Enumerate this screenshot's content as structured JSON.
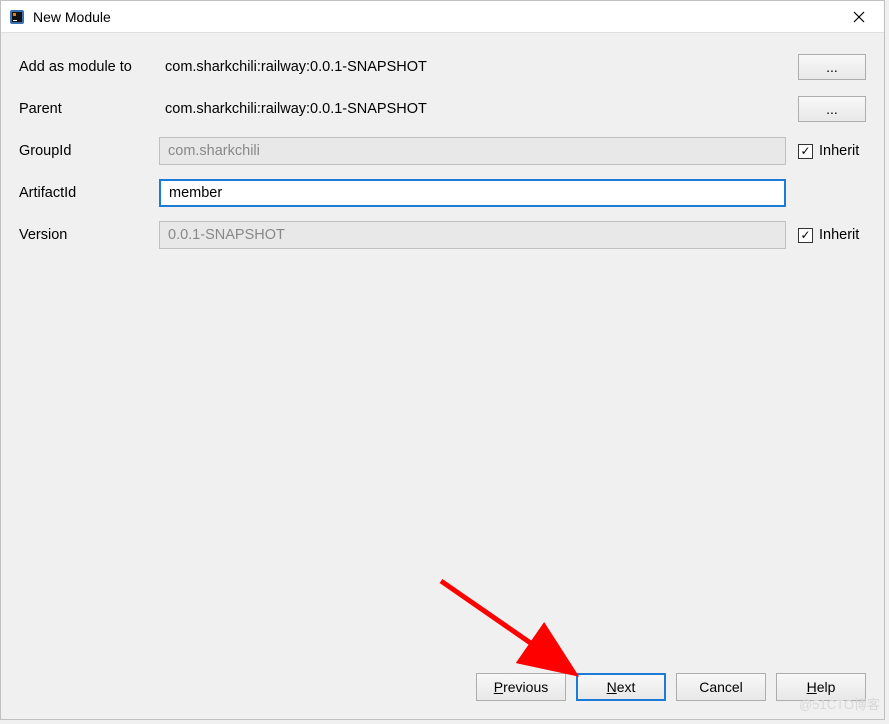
{
  "title_bar": {
    "title": "New Module"
  },
  "form": {
    "add_as_module_to": {
      "label": "Add as module to",
      "value": "com.sharkchili:railway:0.0.1-SNAPSHOT",
      "browse": "..."
    },
    "parent": {
      "label": "Parent",
      "value": "com.sharkchili:railway:0.0.1-SNAPSHOT",
      "browse": "..."
    },
    "group_id": {
      "label": "GroupId",
      "value": "com.sharkchili",
      "inherit_label": "Inherit",
      "inherit_checked": true
    },
    "artifact_id": {
      "label": "ArtifactId",
      "value": "member"
    },
    "version": {
      "label": "Version",
      "value": "0.0.1-SNAPSHOT",
      "inherit_label": "Inherit",
      "inherit_checked": true
    }
  },
  "buttons": {
    "previous": "Previous",
    "next": "Next",
    "cancel": "Cancel",
    "help": "Help"
  },
  "watermark": "@51CTO博客"
}
